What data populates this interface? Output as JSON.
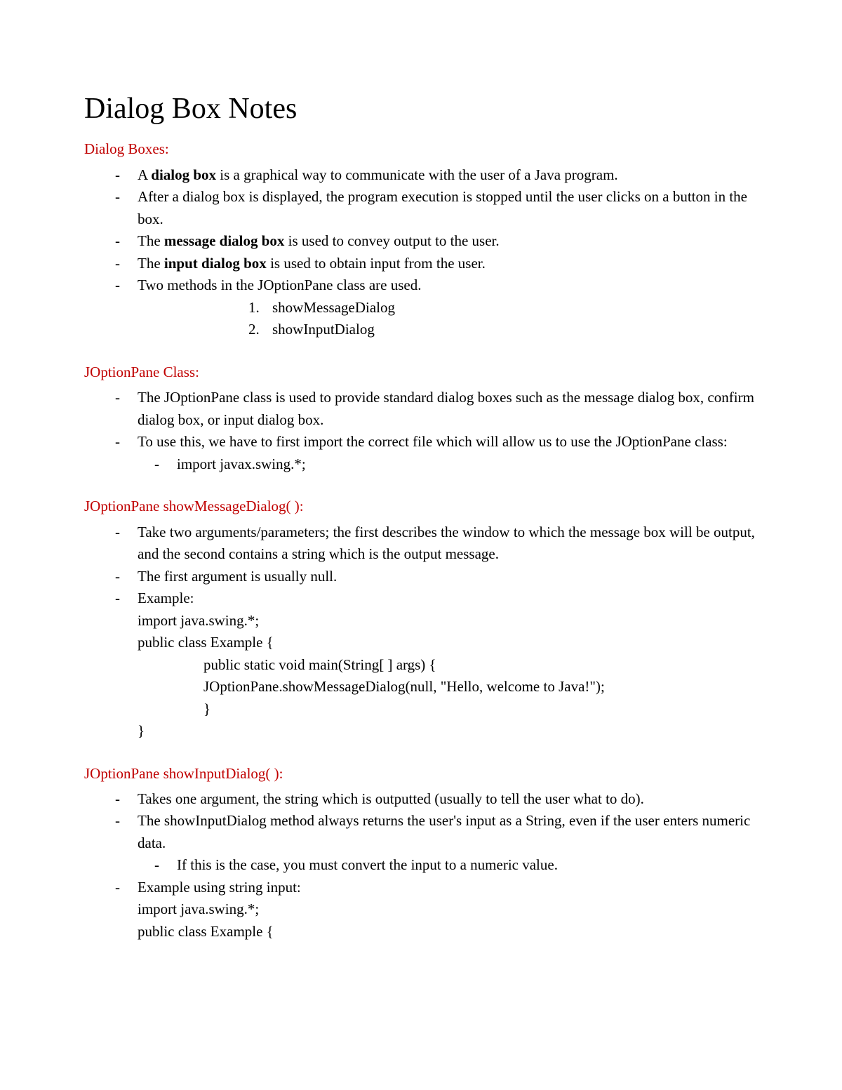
{
  "title": "Dialog Box Notes",
  "sections": {
    "dialogBoxes": {
      "header": "Dialog Boxes:",
      "bullets": {
        "b1_pre": "A ",
        "b1_bold": "dialog box",
        "b1_post": " is a graphical way to communicate with the user of a Java program.",
        "b2": "After a dialog box is displayed, the program execution is stopped until the user clicks on a button in the box.",
        "b3_pre": "The ",
        "b3_bold": "message dialog box",
        "b3_post": " is used to convey output to the user.",
        "b4_pre": "The ",
        "b4_bold": "input dialog box",
        "b4_post": " is used to obtain input from the user.",
        "b5": "Two methods in the JOptionPane class are used.",
        "num1": "showMessageDialog",
        "num2": "showInputDialog"
      }
    },
    "joptionClass": {
      "header": "JOptionPane Class:",
      "bullets": {
        "b1": "The JOptionPane class is used to provide standard dialog boxes such as the message dialog box, confirm dialog box, or input dialog box.",
        "b2": "To use this, we have to first import the correct file which will allow us to use the JOptionPane class:",
        "sub1": "import javax.swing.*;"
      }
    },
    "showMessage": {
      "header": "JOptionPane showMessageDialog( ):",
      "bullets": {
        "b1": "Take two arguments/parameters; the first describes the window to which the message box will be output, and the second contains a string which is the output message.",
        "b2": "The first argument is usually null.",
        "b3": "Example:",
        "code": {
          "line1": "import java.swing.*;",
          "line2": "public class Example {",
          "line3": "public static void main(String[ ] args) {",
          "line4": "JOptionPane.showMessageDialog(null, \"Hello, welcome to Java!\");",
          "line5": "}",
          "line6": "}"
        }
      }
    },
    "showInput": {
      "header": "JOptionPane showInputDialog( ):",
      "bullets": {
        "b1": "Takes one argument, the string which is outputted (usually to tell the user what to do).",
        "b2": "The showInputDialog method always returns the user's input as a String, even if the user enters numeric data.",
        "sub1": "If this is the case, you must convert the input to a numeric value.",
        "b3": "Example using string input:",
        "code": {
          "line1": "import java.swing.*;",
          "line2": "public class Example {"
        }
      }
    }
  }
}
